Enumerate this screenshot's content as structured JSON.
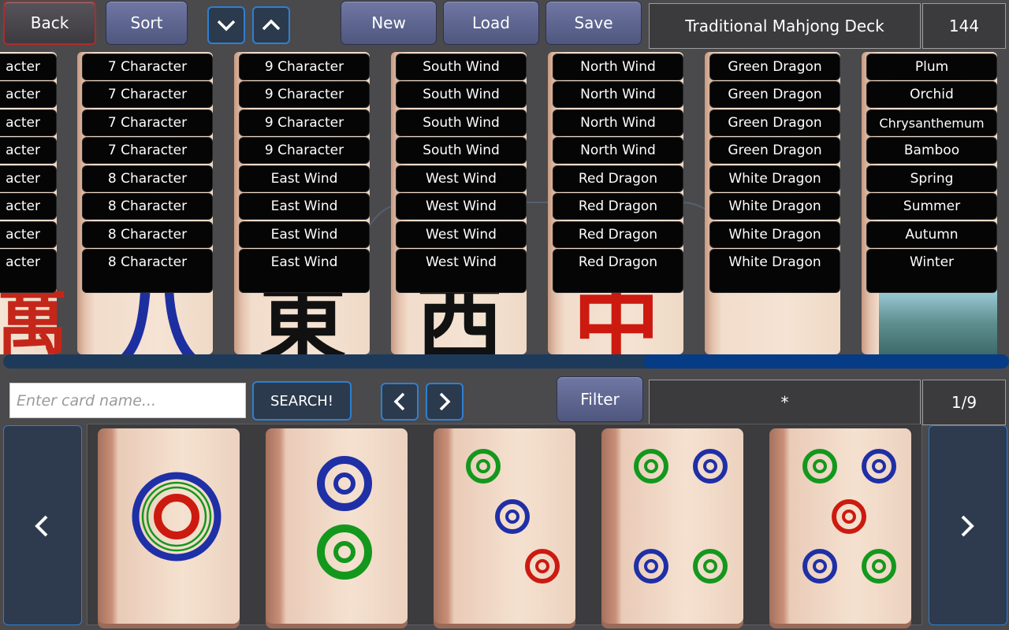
{
  "toolbar": {
    "back_label": "Back",
    "sort_label": "Sort",
    "new_label": "New",
    "load_label": "Load",
    "save_label": "Save",
    "deck_name": "Traditional Mahjong Deck",
    "deck_count": "144"
  },
  "deck_columns": [
    {
      "labels": [
        "acter",
        "acter",
        "acter",
        "acter",
        "acter",
        "acter",
        "acter",
        "acter"
      ]
    },
    {
      "labels": [
        "7 Character",
        "7 Character",
        "7 Character",
        "7 Character",
        "8 Character",
        "8 Character",
        "8 Character",
        "8 Character"
      ]
    },
    {
      "labels": [
        "9 Character",
        "9 Character",
        "9 Character",
        "9 Character",
        "East Wind",
        "East Wind",
        "East Wind",
        "East Wind"
      ]
    },
    {
      "labels": [
        "South Wind",
        "South Wind",
        "South Wind",
        "South Wind",
        "West Wind",
        "West Wind",
        "West Wind",
        "West Wind"
      ]
    },
    {
      "labels": [
        "North Wind",
        "North Wind",
        "North Wind",
        "North Wind",
        "Red Dragon",
        "Red Dragon",
        "Red Dragon",
        "Red Dragon"
      ]
    },
    {
      "labels": [
        "Green Dragon",
        "Green Dragon",
        "Green Dragon",
        "Green Dragon",
        "White Dragon",
        "White Dragon",
        "White Dragon",
        "White Dragon"
      ]
    },
    {
      "labels": [
        "Plum",
        "Orchid",
        "Chrysanthemum",
        "Bamboo",
        "Spring",
        "Summer",
        "Autumn",
        "Winter"
      ]
    }
  ],
  "search": {
    "placeholder": "Enter card name...",
    "button_label": "SEARCH!"
  },
  "filter": {
    "label": "Filter",
    "value": "*",
    "page": "1/9"
  },
  "tray_cards": [
    {
      "name": "1 Circle"
    },
    {
      "name": "2 Circle"
    },
    {
      "name": "3 Circle"
    },
    {
      "name": "4 Circle"
    },
    {
      "name": "5 Circle"
    }
  ],
  "colors": {
    "button": "#5f6792",
    "accent_blue": "#2f7fd0",
    "back_border": "#b12a2a",
    "dot_blue": "#1f2fa6",
    "dot_green": "#13981d",
    "dot_red": "#cc1a10"
  }
}
